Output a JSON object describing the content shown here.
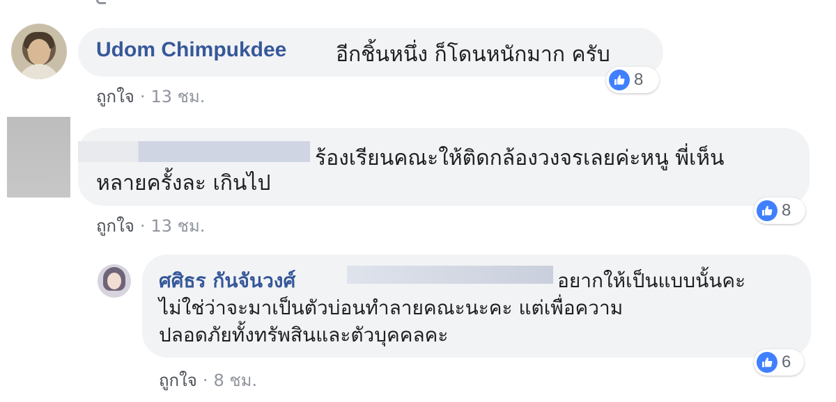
{
  "comments": [
    {
      "author": "Udom Chimpukdee",
      "text": "อีกชิ้นหนึ่ง ก็โดนหนักมาก ครับ",
      "like_label": "ถูกใจ",
      "separator": "·",
      "time": "13 ชม.",
      "reaction_count": "8"
    },
    {
      "text_line1": "ร้องเรียนคณะให้ติดกล้องวงจรเลยค่ะหนู พี่เห็น",
      "text_line2": "หลายครั้งละ เกินไป",
      "like_label": "ถูกใจ",
      "separator": "·",
      "time": "13 ชม.",
      "reaction_count": "8"
    },
    {
      "author": "ศศิธร กันจันวงศ์",
      "text_line1": "อยากให้เป็นแบบนั้นคะ",
      "text_line2": "ไม่ใช่ว่าจะมาเป็นตัวบ่อนทำลายคณะนะคะ แต่เพื่อความ",
      "text_line3": "ปลอดภัยทั้งทรัพสินและตัวบุคคลคะ",
      "like_label": "ถูกใจ",
      "separator": "·",
      "time": "8 ชม.",
      "reaction_count": "6"
    }
  ],
  "icons": {
    "reaction": "like-thumbs-up-icon"
  },
  "colors": {
    "author": "#365899",
    "bubble": "#f2f3f5",
    "meta": "#90949c",
    "like_badge": "#4080ff"
  }
}
